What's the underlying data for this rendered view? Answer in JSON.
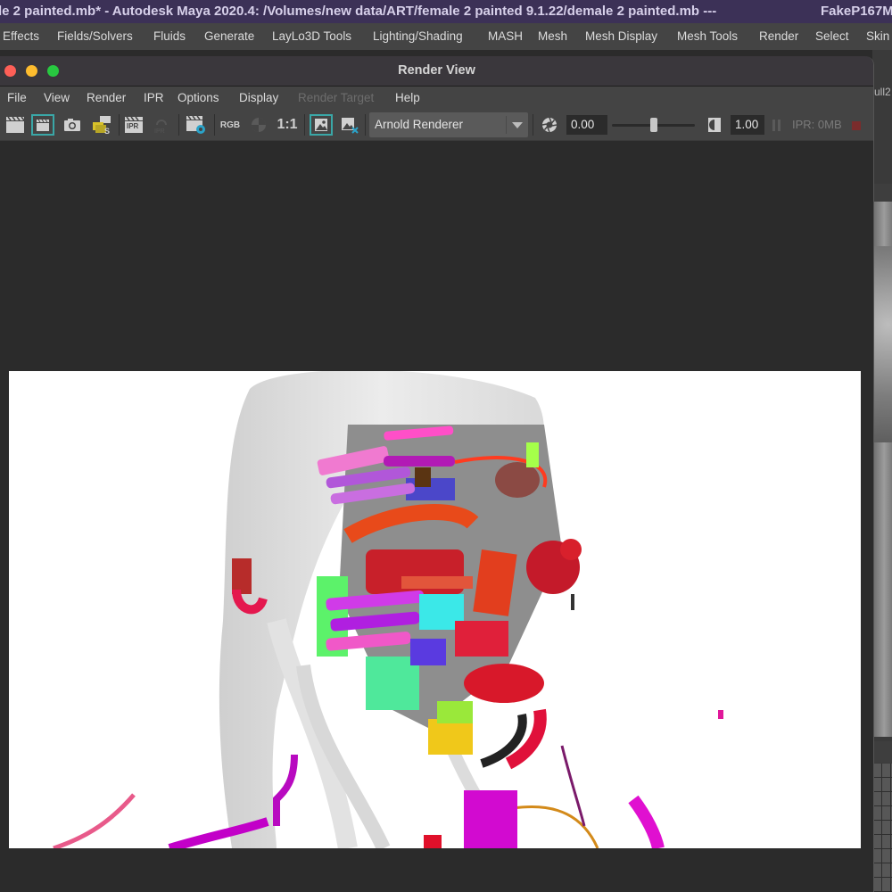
{
  "app": {
    "title": "le 2 painted.mb* - Autodesk Maya 2020.4: /Volumes/new data/ART/female 2 painted 9.1.22/demale 2 painted.mb   ---   ",
    "title_suffix": "FakeP167M",
    "menu": [
      "Effects",
      "Fields/Solvers",
      "Fluids",
      "Generate",
      "LayLo3D Tools",
      "Lighting/Shading",
      "MASH",
      "Mesh",
      "Mesh Display",
      "Mesh Tools",
      "Render",
      "Select",
      "Skin"
    ]
  },
  "background": {
    "viewport_label": "ull2"
  },
  "render_view": {
    "title": "Render View",
    "menu": [
      {
        "label": "File",
        "enabled": true
      },
      {
        "label": "View",
        "enabled": true
      },
      {
        "label": "Render",
        "enabled": true
      },
      {
        "label": "IPR",
        "enabled": true
      },
      {
        "label": "Options",
        "enabled": true
      },
      {
        "label": "Display",
        "enabled": true
      },
      {
        "label": "Render Target",
        "enabled": false
      },
      {
        "label": "Help",
        "enabled": true
      }
    ],
    "toolbar": {
      "icons": [
        "redo-render-icon",
        "render-region-icon",
        "snapshot-icon",
        "render-sequence-icon",
        "ipr-render-icon",
        "refresh-ipr-icon",
        "render-settings-icon",
        "rgb-channels-icon",
        "exposure-toggle-icon",
        "real-size-icon",
        "keep-image-icon",
        "remove-image-icon"
      ],
      "rgb_label": "RGB",
      "ipr_label": "IPR",
      "real_size_label": "1:1",
      "renderer": "Arnold Renderer",
      "exposure_value": "0.00",
      "gamma_slider_fraction": 0.5,
      "gamma_value": "1.00",
      "ipr_memory": "IPR: 0MB"
    },
    "colors": {
      "accent": "#3aa7a7",
      "stop": "#7a2c2c",
      "title_bar": "#3c3157"
    }
  }
}
